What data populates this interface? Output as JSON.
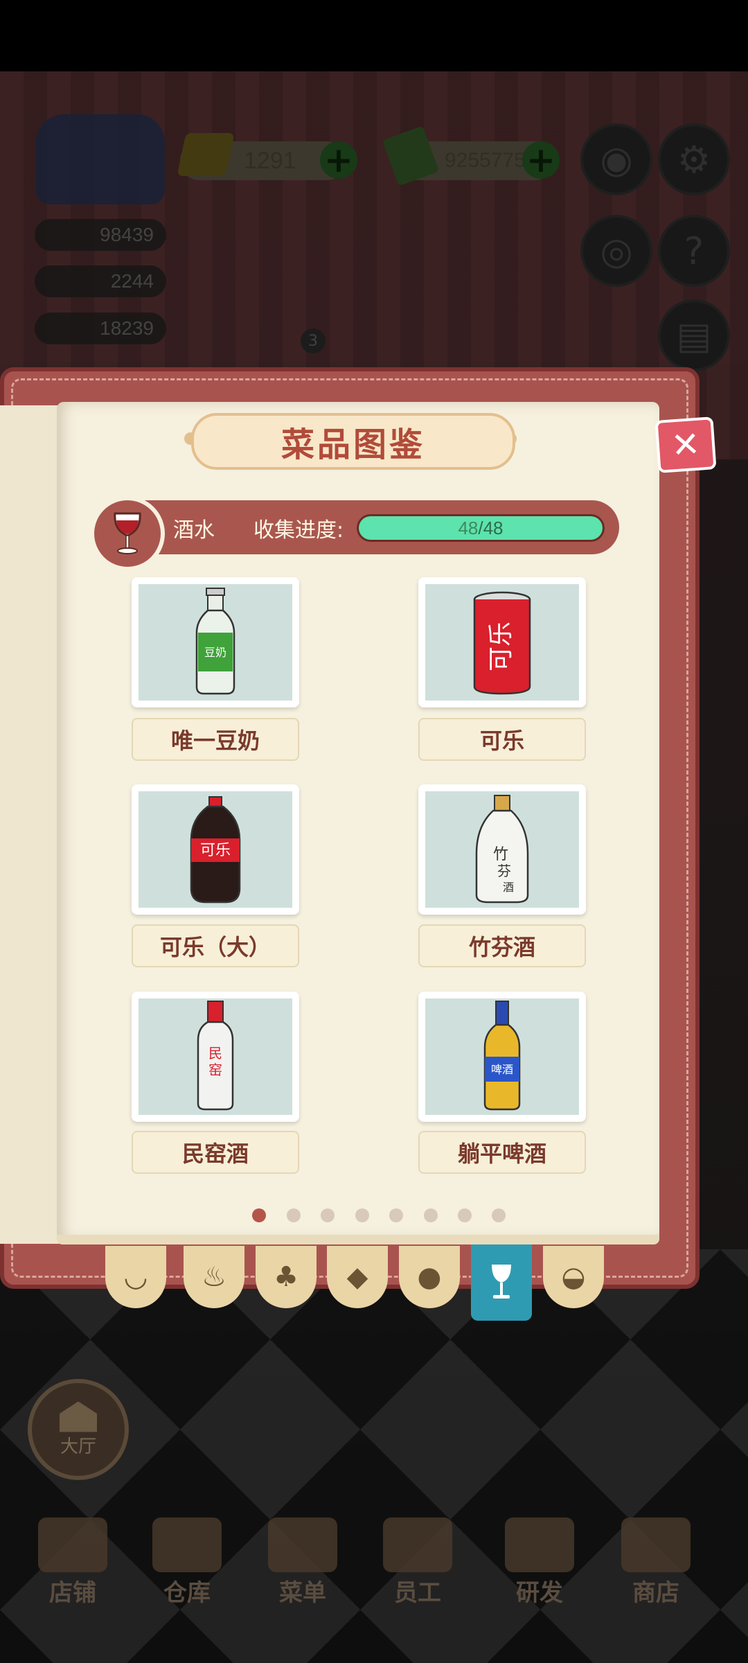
{
  "hud": {
    "gold": "1291",
    "cash": "9255775",
    "stats": [
      "98439",
      "2244",
      "18239"
    ],
    "badge_count": "3"
  },
  "book": {
    "title": "菜品图鉴",
    "category": "酒水",
    "collect_label": "收集进度:",
    "progress_current": "48",
    "progress_total": "/48",
    "progress_fraction": 1.0,
    "items": [
      {
        "name": "唯一豆奶",
        "icon": "soy-milk-bottle-icon"
      },
      {
        "name": "可乐",
        "icon": "cola-can-icon"
      },
      {
        "name": "可乐（大）",
        "icon": "cola-bottle-large-icon"
      },
      {
        "name": "竹芬酒",
        "icon": "bamboo-liquor-bottle-icon"
      },
      {
        "name": "民窑酒",
        "icon": "minyao-liquor-bottle-icon"
      },
      {
        "name": "躺平啤酒",
        "icon": "beer-bottle-icon"
      }
    ],
    "page_count": 8,
    "current_page": 1,
    "tabs": [
      "wok-icon",
      "drumstick-icon",
      "broccoli-icon",
      "fish-icon",
      "bread-icon",
      "wine-glass-icon",
      "soup-bowl-icon"
    ],
    "active_tab": 5
  },
  "hall_label": "大厅",
  "nav": [
    "店铺",
    "仓库",
    "菜单",
    "员工",
    "研发",
    "商店"
  ],
  "colors": {
    "accent": "#b14b3a",
    "progress": "#5de3ad",
    "active_tab": "#2f9bb2"
  }
}
